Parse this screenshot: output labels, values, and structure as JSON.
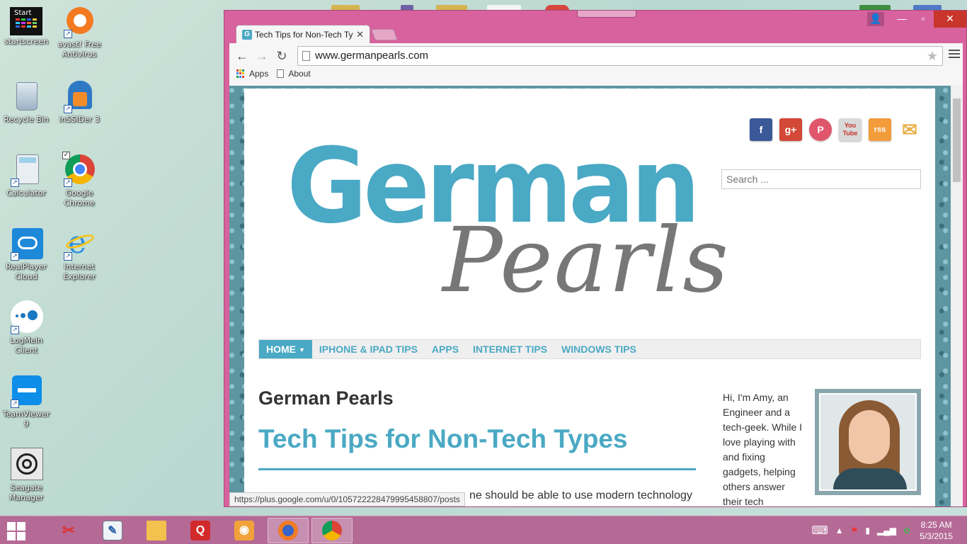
{
  "desktop": {
    "icons": [
      {
        "label": "startscreen",
        "icon": "startscreen-icon"
      },
      {
        "label": "avast! Free Antivirus",
        "icon": "avast-icon"
      },
      {
        "label": "Recycle Bin",
        "icon": "recycle-bin-icon"
      },
      {
        "label": "inSSIDer 3",
        "icon": "inssider-icon"
      },
      {
        "label": "Calculator",
        "icon": "calculator-icon"
      },
      {
        "label": "Google Chrome",
        "icon": "chrome-icon"
      },
      {
        "label": "RealPlayer Cloud",
        "icon": "realplayer-icon"
      },
      {
        "label": "Internet Explorer",
        "icon": "ie-icon"
      },
      {
        "label": "LogMeIn Client",
        "icon": "logmein-icon"
      },
      {
        "label": "TeamViewer 9",
        "icon": "teamviewer-icon"
      },
      {
        "label": "Seagate Manager",
        "icon": "seagate-icon"
      }
    ],
    "startscreen_caption": "Start"
  },
  "browser": {
    "tab_title": "Tech Tips for Non-Tech Ty",
    "tab_close": "✕",
    "url": "www.germanpearls.com",
    "bookmarks": [
      {
        "label": "Apps"
      },
      {
        "label": "About"
      }
    ],
    "status_url": "https://plus.google.com/u/0/105722228479995458807/posts"
  },
  "page": {
    "logo_top": "German",
    "logo_bottom": "Pearls",
    "search_placeholder": "Search ...",
    "social": [
      {
        "label": "f",
        "icon": "facebook-icon",
        "color": "#3b5998"
      },
      {
        "label": "g+",
        "icon": "google-plus-icon",
        "color": "#d34836"
      },
      {
        "label": "P",
        "icon": "pinterest-icon",
        "color": "#e0566b"
      },
      {
        "label": "You Tube",
        "icon": "youtube-icon",
        "color": "#d9d9d9"
      },
      {
        "label": "rss",
        "icon": "rss-icon",
        "color": "#f39c3c"
      },
      {
        "label": "✉",
        "icon": "email-icon",
        "color": "#f2c35a"
      }
    ],
    "nav": [
      {
        "label": "HOME",
        "active": true
      },
      {
        "label": "IPHONE & IPAD TIPS"
      },
      {
        "label": "APPS"
      },
      {
        "label": "INTERNET TIPS"
      },
      {
        "label": "WINDOWS TIPS"
      }
    ],
    "site_title": "German Pearls",
    "tagline": "Tech Tips for Non-Tech Types",
    "intro_tail": "ne should be able to use modern technology",
    "bio": "Hi, I'm Amy, an Engineer and a tech-geek. While I love playing with and fixing gadgets, helping others answer their tech"
  },
  "taskbar": {
    "time": "8:25 AM",
    "date": "5/3/2015",
    "apps": [
      "snipping-tool-icon",
      "paint-icon",
      "file-explorer-icon",
      "quicken-icon",
      "avast-icon",
      "firefox-icon",
      "chrome-icon"
    ]
  },
  "colors": {
    "accent": "#4aa9c4",
    "window_frame": "#d7629e",
    "taskbar": "#b56a96"
  }
}
